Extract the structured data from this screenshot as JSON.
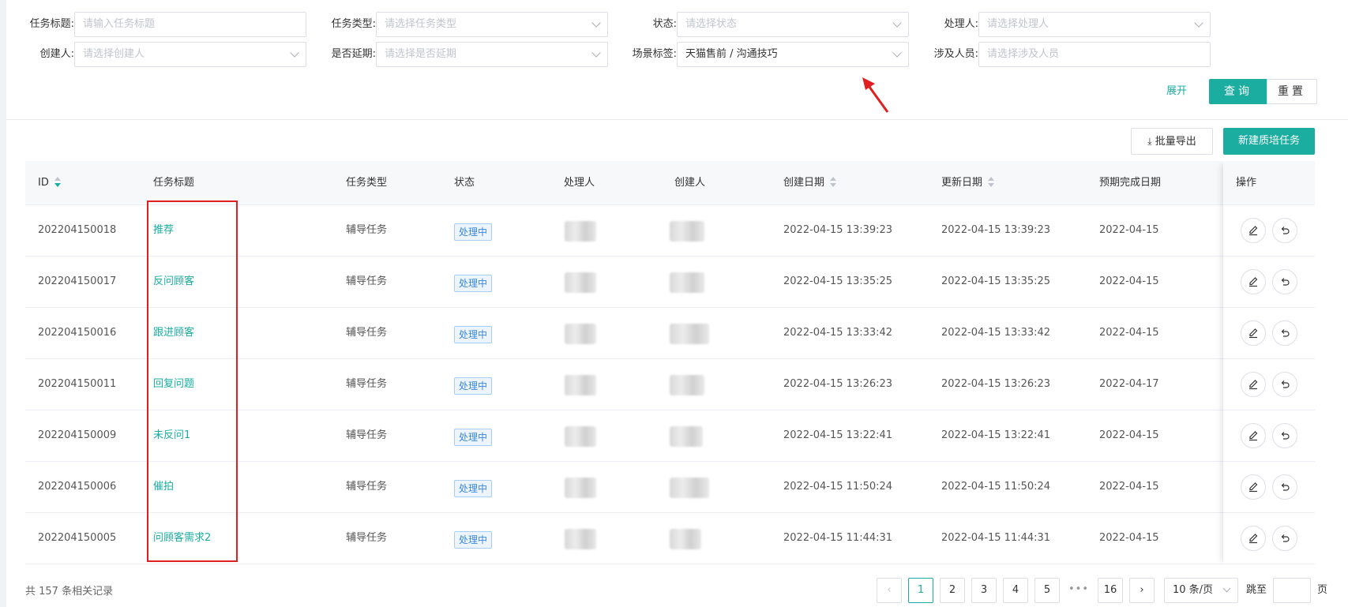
{
  "filters": {
    "row1": [
      {
        "label": "任务标题:",
        "value": "",
        "placeholder": "请输入任务标题",
        "type": "input"
      },
      {
        "label": "任务类型:",
        "value": "",
        "placeholder": "请选择任务类型",
        "type": "select"
      },
      {
        "label": "状态:",
        "value": "",
        "placeholder": "请选择状态",
        "type": "select"
      },
      {
        "label": "处理人:",
        "value": "",
        "placeholder": "请选择处理人",
        "type": "select"
      }
    ],
    "row2": [
      {
        "label": "创建人:",
        "value": "",
        "placeholder": "请选择创建人",
        "type": "select"
      },
      {
        "label": "是否延期:",
        "value": "",
        "placeholder": "请选择是否延期",
        "type": "select"
      },
      {
        "label": "场景标签:",
        "value": "天猫售前 / 沟通技巧",
        "placeholder": "",
        "type": "select"
      },
      {
        "label": "涉及人员:",
        "value": "",
        "placeholder": "请选择涉及人员",
        "type": "input"
      }
    ],
    "expand_label": "展开",
    "query_label": "查询",
    "reset_label": "重置"
  },
  "toolbar": {
    "export_label": "批量导出",
    "new_label": "新建质培任务"
  },
  "table": {
    "columns": [
      "ID",
      "任务标题",
      "任务类型",
      "状态",
      "处理人",
      "创建人",
      "创建日期",
      "更新日期",
      "预期完成日期",
      "操作"
    ],
    "rows": [
      {
        "id": "202204150018",
        "title": "推荐",
        "type": "辅导任务",
        "status": "处理中",
        "created": "2022-04-15 13:39:23",
        "updated": "2022-04-15 13:39:23",
        "due": "2022-04-15"
      },
      {
        "id": "202204150017",
        "title": "反问顾客",
        "type": "辅导任务",
        "status": "处理中",
        "created": "2022-04-15 13:35:25",
        "updated": "2022-04-15 13:35:25",
        "due": "2022-04-15"
      },
      {
        "id": "202204150016",
        "title": "跟进顾客",
        "type": "辅导任务",
        "status": "处理中",
        "created": "2022-04-15 13:33:42",
        "updated": "2022-04-15 13:33:42",
        "due": "2022-04-15"
      },
      {
        "id": "202204150011",
        "title": "回复问题",
        "type": "辅导任务",
        "status": "处理中",
        "created": "2022-04-15 13:26:23",
        "updated": "2022-04-15 13:26:23",
        "due": "2022-04-17"
      },
      {
        "id": "202204150009",
        "title": "未反问1",
        "type": "辅导任务",
        "status": "处理中",
        "created": "2022-04-15 13:22:41",
        "updated": "2022-04-15 13:22:41",
        "due": "2022-04-15"
      },
      {
        "id": "202204150006",
        "title": "催拍",
        "type": "辅导任务",
        "status": "处理中",
        "created": "2022-04-15 11:50:24",
        "updated": "2022-04-15 11:50:24",
        "due": "2022-04-15"
      },
      {
        "id": "202204150005",
        "title": "问顾客需求2",
        "type": "辅导任务",
        "status": "处理中",
        "created": "2022-04-15 11:44:31",
        "updated": "2022-04-15 11:44:31",
        "due": "2022-04-15"
      }
    ]
  },
  "pagination": {
    "total_text": "共 157 条相关记录",
    "pages": [
      "1",
      "2",
      "3",
      "4",
      "5"
    ],
    "more": "•••",
    "last_page": "16",
    "current": "1",
    "page_size": "10 条/页",
    "jump_label": "跳至",
    "page_unit": "页"
  },
  "colors": {
    "accent": "#1aada0",
    "tag_blue": "#3a87d9",
    "highlight": "#e02020"
  }
}
